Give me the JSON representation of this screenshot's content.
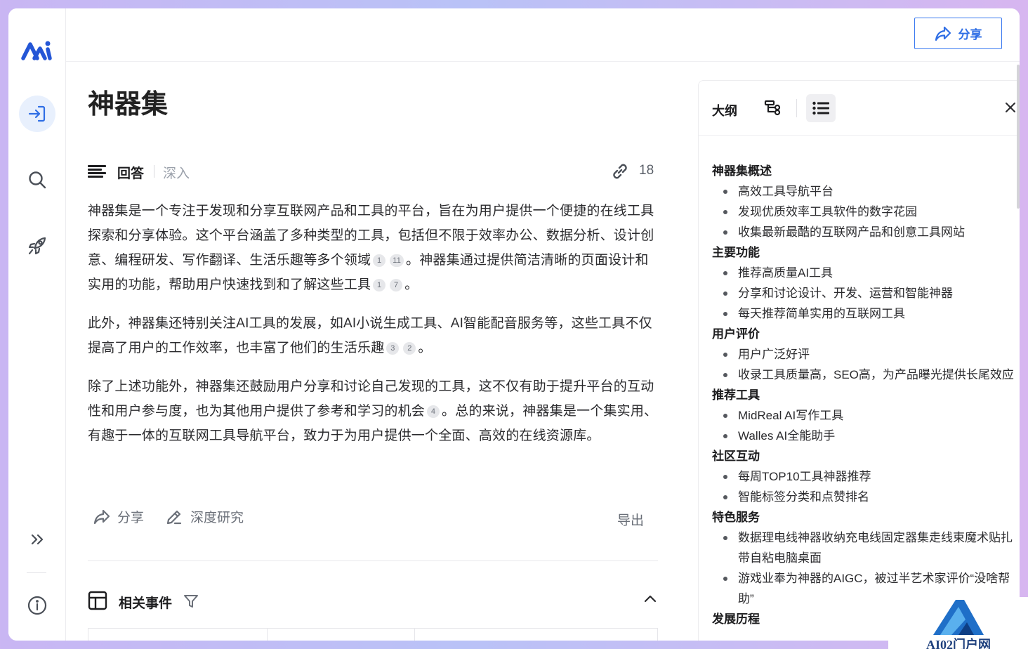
{
  "header": {
    "share_label": "分享"
  },
  "page": {
    "title": "神器集"
  },
  "answer": {
    "tab_answer": "回答",
    "tab_deep": "深入",
    "source_count": "18",
    "paragraphs": [
      {
        "segments": [
          {
            "t": "神器集是一个专注于发现和分享互联网产品和工具的平台，旨在为用户提供一个便捷的在线工具探索和分享体验。这个平台涵盖了多种类型的工具，包括但不限于效率办公、数据分析、设计创意、编程研发、写作翻译、生活乐趣等多个领域"
          },
          {
            "c": "1"
          },
          {
            "c": "11"
          },
          {
            "t": "。神器集通过提供简洁清晰的页面设计和实用的功能，帮助用户快速找到和了解这些工具"
          },
          {
            "c": "1"
          },
          {
            "c": "7"
          },
          {
            "t": "。"
          }
        ]
      },
      {
        "segments": [
          {
            "t": "此外，神器集还特别关注AI工具的发展，如AI小说生成工具、AI智能配音服务等，这些工具不仅提高了用户的工作效率，也丰富了他们的生活乐趣"
          },
          {
            "c": "3"
          },
          {
            "c": "2"
          },
          {
            "t": "。"
          }
        ]
      },
      {
        "segments": [
          {
            "t": "除了上述功能外，神器集还鼓励用户分享和讨论自己发现的工具，这不仅有助于提升平台的互动性和用户参与度，也为其他用户提供了参考和学习的机会"
          },
          {
            "c": "4"
          },
          {
            "t": "。总的来说，神器集是一个集实用、有趣于一体的互联网工具导航平台，致力于为用户提供一个全面、高效的在线资源库。"
          }
        ]
      }
    ],
    "actions": {
      "share": "分享",
      "deep_research": "深度研究",
      "export": "导出"
    }
  },
  "events": {
    "title": "相关事件"
  },
  "outline": {
    "label": "大纲",
    "sections": [
      {
        "title": "神器集概述",
        "items": [
          "高效工具导航平台",
          "发现优质效率工具软件的数字花园",
          "收集最新最酷的互联网产品和创意工具网站"
        ]
      },
      {
        "title": "主要功能",
        "items": [
          "推荐高质量AI工具",
          "分享和讨论设计、开发、运营和智能神器",
          "每天推荐简单实用的互联网工具"
        ]
      },
      {
        "title": "用户评价",
        "items": [
          "用户广泛好评",
          "收录工具质量高，SEO高，为产品曝光提供长尾效应"
        ]
      },
      {
        "title": "推荐工具",
        "items": [
          "MidReal AI写作工具",
          "Walles AI全能助手"
        ]
      },
      {
        "title": "社区互动",
        "items": [
          "每周TOP10工具神器推荐",
          "智能标签分类和点赞排名"
        ]
      },
      {
        "title": "特色服务",
        "items": [
          "数据理电线神器收纳充电线固定器集走线束魔术贴扎带自粘电脑桌面",
          "游戏业奉为神器的AIGC，被过半艺术家评价“没啥帮助”"
        ]
      },
      {
        "title": "发展历程",
        "items": []
      }
    ]
  },
  "watermark": {
    "text": "AI02门户网"
  },
  "colors": {
    "accent": "#2f6ee5",
    "brand": "#2456d6",
    "text": "#2b2b2e",
    "muted": "#9aa0aa"
  }
}
